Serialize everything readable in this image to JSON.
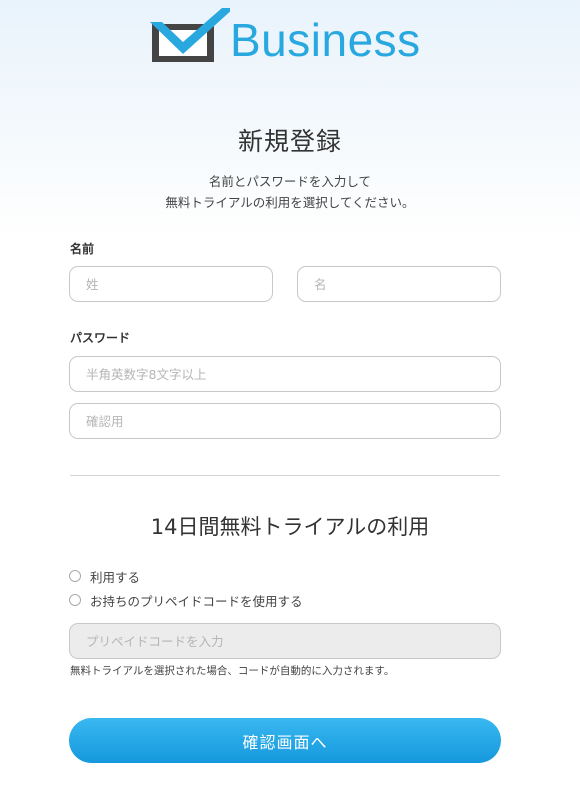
{
  "brand": {
    "name": "Business",
    "color": "#29a8e0",
    "icon": "mail-envelope-logo"
  },
  "page": {
    "title": "新規登録",
    "subtitle_line1": "名前とパスワードを入力して",
    "subtitle_line2": "無料トライアルの利用を選択してください。"
  },
  "name_section": {
    "label": "名前",
    "last_placeholder": "姓",
    "first_placeholder": "名"
  },
  "password_section": {
    "label": "パスワード",
    "password_placeholder": "半角英数字8文字以上",
    "confirm_placeholder": "確認用"
  },
  "trial_section": {
    "title": "14日間無料トライアルの利用",
    "options": [
      "利用する",
      "お持ちのプリペイドコードを使用する"
    ],
    "code_placeholder": "プリペイドコードを入力",
    "note": "無料トライアルを選択された場合、コードが自動的に入力されます。"
  },
  "submit": {
    "label": "確認画面へ",
    "color": "#1e9fe3"
  }
}
